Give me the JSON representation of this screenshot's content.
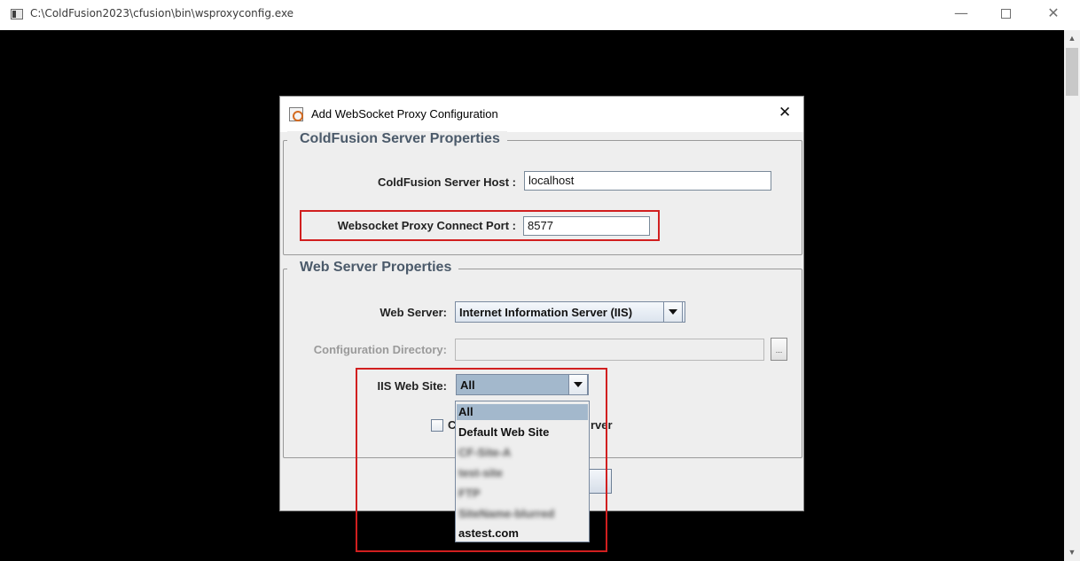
{
  "window": {
    "title": "C:\\ColdFusion2023\\cfusion\\bin\\wsproxyconfig.exe",
    "minimize": "—",
    "close": "✕"
  },
  "dialog": {
    "title": "Add WebSocket Proxy Configuration",
    "close": "✕"
  },
  "cf_group": {
    "legend": "ColdFusion Server Properties",
    "host_label": "ColdFusion Server Host :",
    "host_value": "localhost",
    "port_label": "Websocket Proxy Connect Port :",
    "port_value": "8577"
  },
  "web_group": {
    "legend": "Web Server Properties",
    "web_server_label": "Web Server:",
    "web_server_value": "Internet Information Server (IIS)",
    "config_dir_label": "Configuration Directory:",
    "config_dir_value": "",
    "browse": "...",
    "iis_site_label": "IIS Web Site:",
    "iis_site_value": "All",
    "checkbox_label_start": "C",
    "checkbox_label_end": "rver"
  },
  "dropdown": {
    "items": [
      "All",
      "Default Web Site",
      "CF-Site-A",
      "test-site",
      "FTP",
      "SiteName-blurred",
      "astest.com"
    ],
    "selected_index": 0
  },
  "colors": {
    "highlight": "#d11f1f",
    "selection": "#a3b8cc"
  }
}
